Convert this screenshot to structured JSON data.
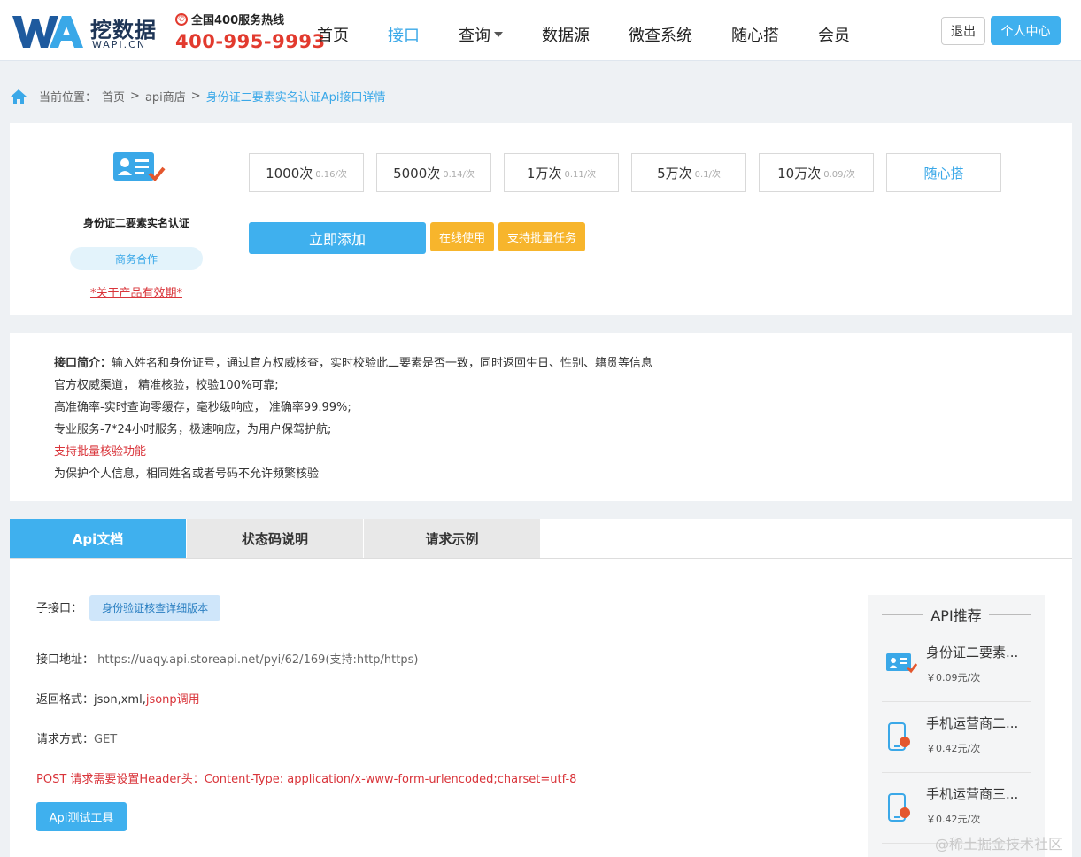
{
  "header": {
    "brand": "挖数据",
    "brand_en": "WAPI.CN",
    "hotline_label": "全国400服务热线",
    "hotline_number": "400-995-9993",
    "nav": [
      "首页",
      "接口",
      "查询",
      "数据源",
      "微查系统",
      "随心搭",
      "会员"
    ],
    "logout": "退出",
    "user_center": "个人中心"
  },
  "breadcrumb": {
    "label": "当前位置：",
    "home": "首页",
    "shop": "api商店",
    "current": "身份证二要素实名认证Api接口详情",
    "sep": ">"
  },
  "product": {
    "name": "身份证二要素实名认证",
    "badge": "商务合作",
    "validity": "*关于产品有效期*",
    "packages": [
      {
        "qty": "1000次",
        "price": "0.16/次"
      },
      {
        "qty": "5000次",
        "price": "0.14/次"
      },
      {
        "qty": "1万次",
        "price": "0.11/次"
      },
      {
        "qty": "5万次",
        "price": "0.1/次"
      },
      {
        "qty": "10万次",
        "price": "0.09/次"
      }
    ],
    "custom": "随心搭",
    "add": "立即添加",
    "online": "在线使用",
    "batch": "支持批量任务"
  },
  "intro": {
    "label": "接口简介：",
    "desc": "输入姓名和身份证号，通过官方权威核查，实时校验此二要素是否一致，同时返回生日、性别、籍贯等信息",
    "line2": "官方权威渠道，  精准核验，校验100%可靠;",
    "line3": "高准确率-实时查询零缓存，毫秒级响应，  准确率99.99%;",
    "line4": "专业服务-7*24小时服务，极速响应，为用户保驾护航;",
    "line5": "支持批量核验功能",
    "line6": "为保护个人信息，相同姓名或者号码不允许频繁核验"
  },
  "docs": {
    "tabs": [
      "Api文档",
      "状态码说明",
      "请求示例"
    ],
    "sub_label": "子接口：",
    "sub_value": "身份验证核查详细版本",
    "addr_label": "接口地址：",
    "addr_value": "https://uaqy.api.storeapi.net/pyi/62/169(支持:http/https)",
    "format_label": "返回格式：",
    "format_value": "json,xml,",
    "format_jsonp": "jsonp调用",
    "method_label": "请求方式：",
    "method_value": "GET",
    "post_note": "POST 请求需要设置Header头：Content-Type: application/x-www-form-urlencoded;charset=utf-8",
    "tool": "Api测试工具"
  },
  "recommend": {
    "title": "API推荐",
    "items": [
      {
        "name": "身份证二要素...",
        "price": "￥0.09元/次",
        "icon": "id-card-icon"
      },
      {
        "name": "手机运营商二...",
        "price": "￥0.42元/次",
        "icon": "phone-2-icon",
        "num": "2"
      },
      {
        "name": "手机运营商三...",
        "price": "￥0.42元/次",
        "icon": "phone-3-icon",
        "num": "3"
      }
    ]
  },
  "watermark": "@稀土掘金技术社区",
  "colors": {
    "accent": "#3fb0ee",
    "yellow": "#f7b52c",
    "red": "#d9343a"
  }
}
